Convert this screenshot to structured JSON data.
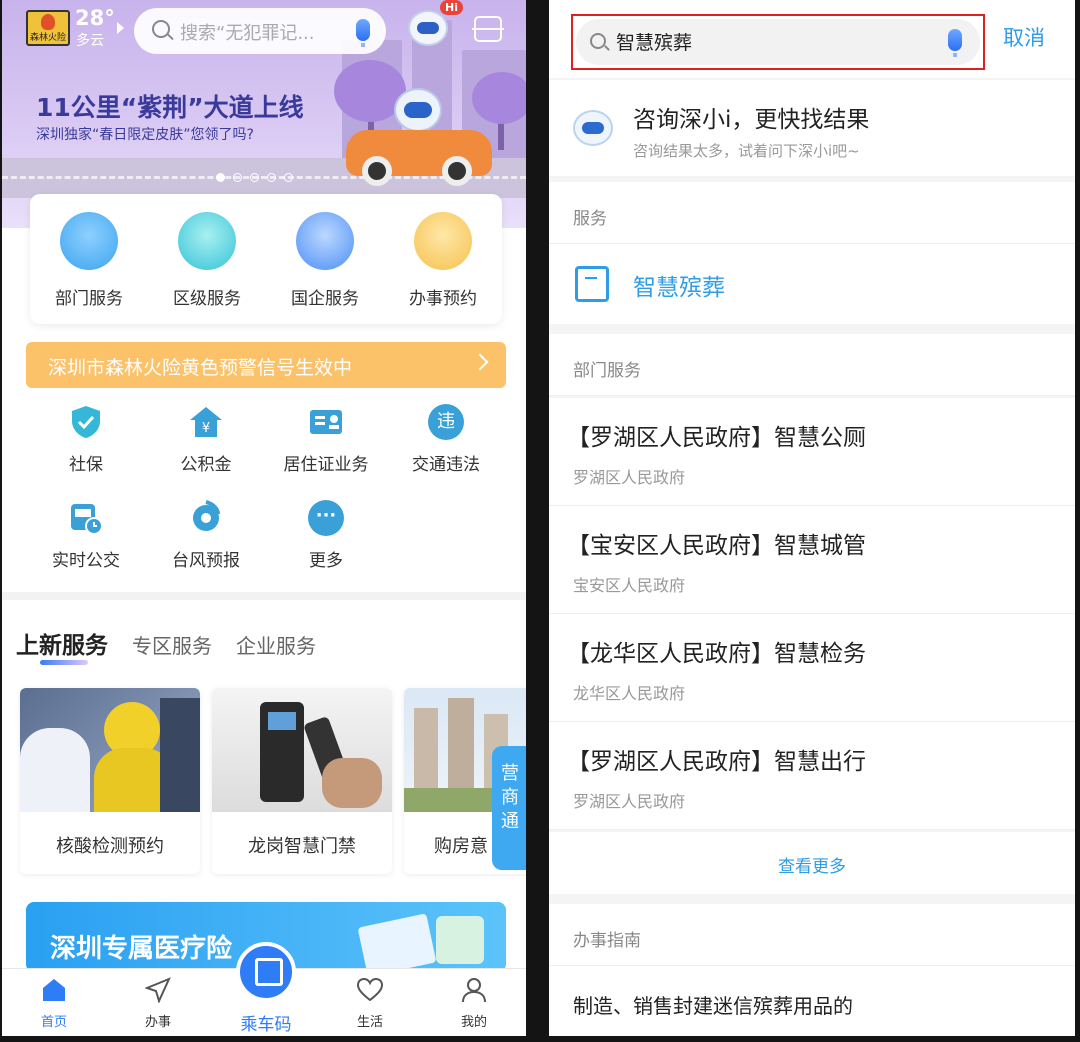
{
  "left": {
    "header": {
      "weather_badge_text": "森林火险",
      "temperature": "28°",
      "weather": "多云",
      "search_placeholder": "搜索“无犯罪记...",
      "hi_badge": "Hi"
    },
    "banner": {
      "title": "11公里“紫荆”大道上线",
      "subtitle": "深圳独家“春日限定皮肤”您领了吗?"
    },
    "quick_services": [
      {
        "label": "部门服务",
        "color": "#3aa4f0"
      },
      {
        "label": "区级服务",
        "color": "#35c3d8"
      },
      {
        "label": "国企服务",
        "color": "#4b8ff5"
      },
      {
        "label": "办事预约",
        "color": "#f6c14d"
      }
    ],
    "alert": {
      "text": "深圳市森林火险黄色预警信号生效中"
    },
    "grid_services": [
      {
        "label": "社保",
        "icon": "shield-check-icon"
      },
      {
        "label": "公积金",
        "icon": "house-yen-icon"
      },
      {
        "label": "居住证业务",
        "icon": "id-card-icon"
      },
      {
        "label": "交通违法",
        "icon": "violation-icon",
        "glyph": "违"
      },
      {
        "label": "实时公交",
        "icon": "bus-clock-icon"
      },
      {
        "label": "台风预报",
        "icon": "typhoon-icon"
      },
      {
        "label": "更多",
        "icon": "more-icon",
        "glyph": "···"
      }
    ],
    "tabs": [
      "上新服务",
      "专区服务",
      "企业服务"
    ],
    "service_cards": [
      {
        "caption": "核酸检测预约"
      },
      {
        "caption": "龙岗智慧门禁"
      },
      {
        "caption": "购房意"
      }
    ],
    "side_tag": "营商通",
    "promo": {
      "title": "深圳专属医疗险"
    },
    "bottom_nav": {
      "home": "首页",
      "tasks": "办事",
      "ride_code": "乘车码",
      "life": "生活",
      "mine": "我的"
    }
  },
  "right": {
    "search": {
      "value": "智慧殡葬",
      "cancel": "取消"
    },
    "ai": {
      "title": "咨询深小i，更快找结果",
      "subtitle": "咨询结果太多，试着问下深小i吧~"
    },
    "service_section": {
      "heading": "服务",
      "item": "智慧殡葬"
    },
    "dept_section": {
      "heading": "部门服务",
      "results": [
        {
          "title": "【罗湖区人民政府】智慧公厕",
          "source": "罗湖区人民政府"
        },
        {
          "title": "【宝安区人民政府】智慧城管",
          "source": "宝安区人民政府"
        },
        {
          "title": "【龙华区人民政府】智慧检务",
          "source": "龙华区人民政府"
        },
        {
          "title": "【罗湖区人民政府】智慧出行",
          "source": "罗湖区人民政府"
        }
      ],
      "more": "查看更多"
    },
    "guide_section": {
      "heading": "办事指南",
      "item": "制造、销售封建迷信殡葬用品的"
    }
  },
  "colors": {
    "accent": "#2e9ce8",
    "alert": "#fbc26a",
    "highlight_border": "#e02020"
  }
}
